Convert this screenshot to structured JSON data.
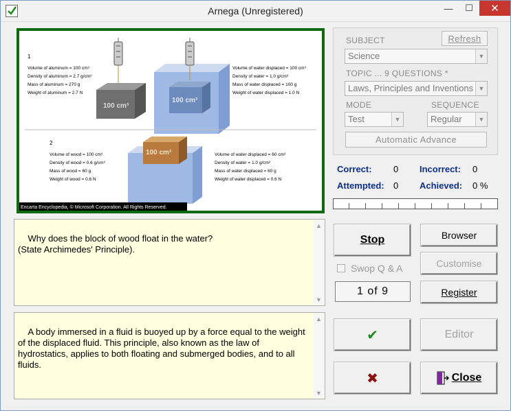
{
  "window": {
    "title": "Arnega (Unregistered)",
    "min_glyph": "—",
    "max_glyph": "☐",
    "close_glyph": "✕"
  },
  "image": {
    "caption": "Encarta Encyclopedia, © Microsoft Corporation. All Rights Reserved.",
    "panel1": {
      "number": "1",
      "left_lines": [
        "Volume of aluminum = 100 cm³",
        "Density of aluminum = 2.7 g/cm³",
        "Mass of aluminum = 270 g",
        "Weight of aluminum = 2.7 N"
      ],
      "right_lines": [
        "Volume of water displaced = 100 cm³",
        "Density of water = 1.0 g/cm³",
        "Mass of water displaced = 100 g",
        "Weight of water displaced = 1.0 N"
      ],
      "block_label_a": "100 cm³",
      "block_label_b": "100 cm³"
    },
    "panel2": {
      "number": "2",
      "left_lines": [
        "Volume of wood = 100 cm³",
        "Density of wood = 0.6 g/cm³",
        "Mass of wood = 60 g",
        "Weight of wood = 0.6 N"
      ],
      "right_lines": [
        "Volume of water displaced = 60 cm³",
        "Density of water = 1.0 g/cm³",
        "Mass of water displaced = 60 g",
        "Weight of water displaced = 0.6 N"
      ],
      "block_label": "100 cm³"
    }
  },
  "settings": {
    "subject_label": "SUBJECT",
    "refresh_label": "Refresh",
    "subject_value": "Science",
    "topic_label": "TOPIC  ...  9  QUESTIONS *",
    "topic_value": "Laws, Principles and Inventions",
    "mode_label": "MODE",
    "mode_value": "Test",
    "sequence_label": "SEQUENCE",
    "sequence_value": "Regular",
    "auto_advance_label": "Automatic   Advance"
  },
  "stats": {
    "correct_label": "Correct:",
    "correct_value": "0",
    "incorrect_label": "Incorrect:",
    "incorrect_value": "0",
    "attempted_label": "Attempted:",
    "attempted_value": "0",
    "achieved_label": "Achieved:",
    "achieved_value": "0 %",
    "progress_fraction": 0
  },
  "question": {
    "text": "Why does the block of wood float in the water?\n(State Archimedes' Principle)."
  },
  "answer": {
    "text": "A body immersed in a fluid is buoyed up by a force equal to the weight of the displaced fluid. This principle, also known as the law of hydrostatics, applies to both floating and submerged bodies, and to all fluids."
  },
  "buttons": {
    "stop": "Stop",
    "browser": "Browser",
    "customise": "Customise",
    "swap": "Swop Q & A",
    "counter": "1  of  9",
    "register": "Register",
    "editor": "Editor",
    "close": "Close",
    "correct_glyph": "✔",
    "wrong_glyph": "✖"
  },
  "colors": {
    "frame_green": "#0e6a0e",
    "stat_blue": "#0b2e8a",
    "check_green": "#1a8a1a",
    "cross_red": "#8a1111",
    "textbox_bg": "#ffffe0"
  }
}
